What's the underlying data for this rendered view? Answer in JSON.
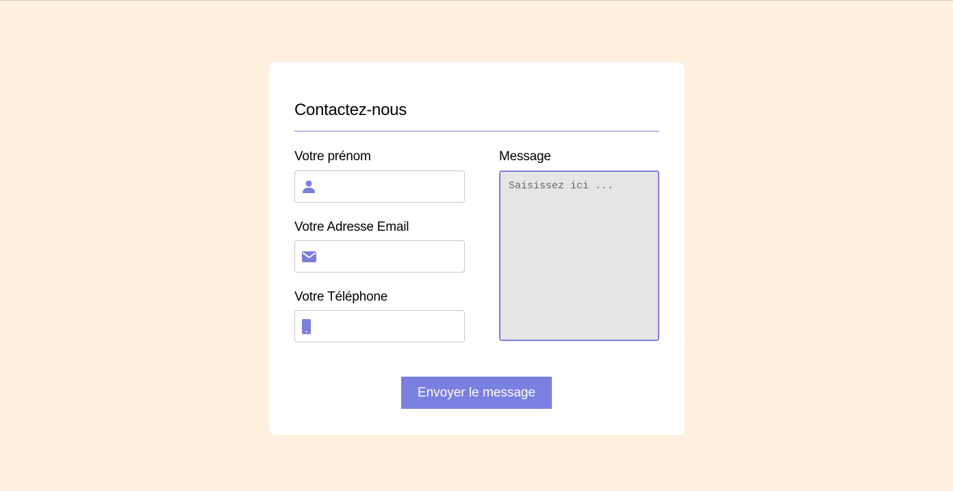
{
  "form": {
    "title": "Contactez-nous",
    "first_name": {
      "label": "Votre prénom",
      "value": "",
      "icon": "user-icon"
    },
    "email": {
      "label": "Votre Adresse Email",
      "value": "",
      "icon": "envelope-icon"
    },
    "phone": {
      "label": "Votre Téléphone",
      "value": "",
      "icon": "mobile-phone-icon"
    },
    "message": {
      "label": "Message",
      "placeholder": "Saisissez ici ...",
      "value": ""
    },
    "submit_label": "Envoyer le message"
  },
  "colors": {
    "background": "#fdf0e0",
    "card": "#ffffff",
    "accent": "#7a7fe0",
    "textarea_bg": "#e6e5e4"
  }
}
